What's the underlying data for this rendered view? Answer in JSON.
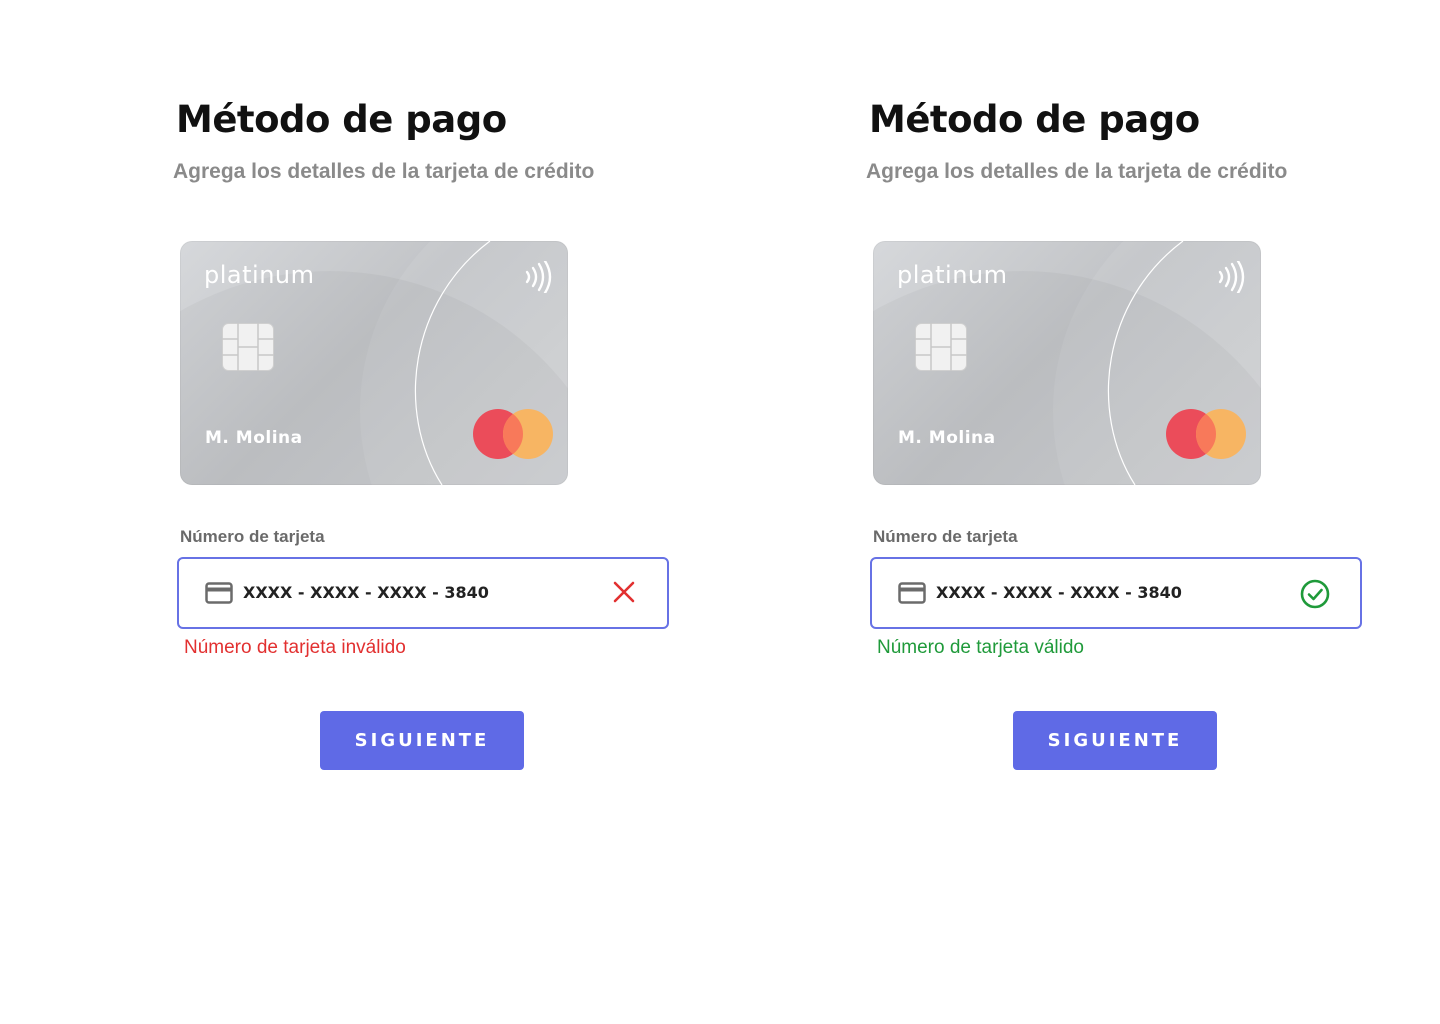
{
  "left": {
    "title": "Método de pago",
    "subtitle": "Agrega los detalles de la tarjeta de crédito",
    "card": {
      "brand": "platinum",
      "holder": "M. Molina"
    },
    "field_label": "Número de tarjeta",
    "card_number": "XXXX - XXXX - XXXX - 3840",
    "status_icon": "close-icon",
    "message": "Número de tarjeta inválido",
    "button": "SIGUIENTE"
  },
  "right": {
    "title": "Método de pago",
    "subtitle": "Agrega los detalles de la tarjeta de crédito",
    "card": {
      "brand": "platinum",
      "holder": "M. Molina"
    },
    "field_label": "Número de tarjeta",
    "card_number": "XXXX - XXXX - XXXX - 3840",
    "status_icon": "check-circle-icon",
    "message": "Número de tarjeta válido",
    "button": "SIGUIENTE"
  },
  "colors": {
    "accent": "#5f6ae6",
    "input_border": "#6772e5",
    "error": "#e23030",
    "success": "#1f9a3a"
  }
}
